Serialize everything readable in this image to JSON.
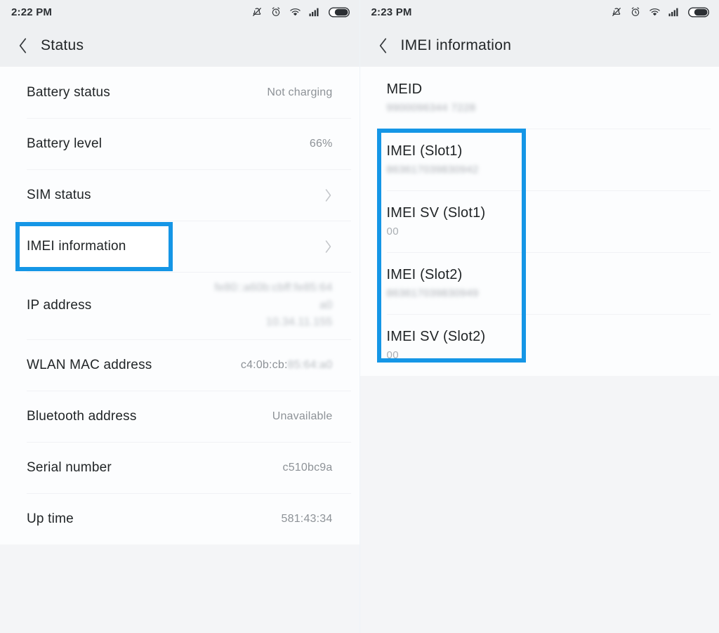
{
  "left": {
    "statusbar": {
      "time": "2:22 PM",
      "icons": [
        "silent-mode-icon",
        "alarm-icon",
        "wifi-icon",
        "signal-icon",
        "battery-icon"
      ]
    },
    "header": {
      "back_label": "back-arrow",
      "title": "Status"
    },
    "rows": [
      {
        "label": "Battery status",
        "value": "Not charging",
        "type": "value",
        "blur": false
      },
      {
        "label": "Battery level",
        "value": "66%",
        "type": "value",
        "blur": false
      },
      {
        "label": "SIM status",
        "value": "",
        "type": "chevron",
        "blur": false
      },
      {
        "label": "IMEI information",
        "value": "",
        "type": "chevron",
        "blur": false,
        "highlighted": true
      },
      {
        "label": "IP address",
        "value": "fe80::a60b:cbff:fe85:64\na0\n10.34.11.155",
        "type": "value-multiline",
        "blur": true
      },
      {
        "label": "WLAN MAC address",
        "value_plain": "c4:0b:cb:",
        "value_blur": "85:64:a0",
        "type": "value-partial-blur"
      },
      {
        "label": "Bluetooth address",
        "value": "Unavailable",
        "type": "value",
        "blur": false
      },
      {
        "label": "Serial number",
        "value": "c510bc9a",
        "type": "value",
        "blur": false
      },
      {
        "label": "Up time",
        "value": "581:43:34",
        "type": "value",
        "blur": false
      }
    ]
  },
  "right": {
    "statusbar": {
      "time": "2:23 PM",
      "icons": [
        "silent-mode-icon",
        "alarm-icon",
        "wifi-icon",
        "signal-icon",
        "battery-icon"
      ]
    },
    "header": {
      "back_label": "back-arrow",
      "title": "IMEI information"
    },
    "rows": [
      {
        "label": "MEID",
        "value": "9900096344 7228",
        "blur": true,
        "highlighted": false
      },
      {
        "label": "IMEI (Slot1)",
        "value": "863617039830942",
        "blur": true,
        "highlighted": true
      },
      {
        "label": "IMEI SV (Slot1)",
        "value": "00",
        "blur": false,
        "highlighted": true
      },
      {
        "label": "IMEI (Slot2)",
        "value": "863617039830949",
        "blur": true,
        "highlighted": true
      },
      {
        "label": "IMEI SV (Slot2)",
        "value": "00",
        "blur": false,
        "highlighted": true
      }
    ]
  },
  "annotation": {
    "highlight_color": "#1596e6",
    "left_target": "IMEI information",
    "right_target": "IMEI slots group"
  },
  "theme": {
    "page_bg": "#f4f5f7",
    "card_bg": "#fcfdfe",
    "header_bg": "#eef0f2",
    "label_color": "#1f2325",
    "value_color": "#8d9297",
    "divider_color": "#f1f2f5"
  }
}
